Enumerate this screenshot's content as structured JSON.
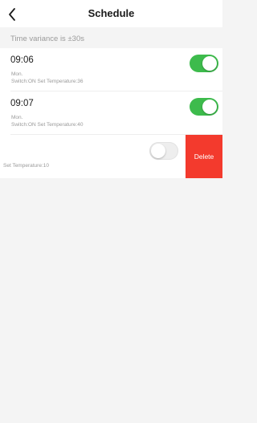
{
  "header": {
    "title": "Schedule",
    "back_icon": "chevron-left-icon"
  },
  "variance": {
    "text": "Time variance is  ±30s"
  },
  "schedules": [
    {
      "time": "09:06",
      "days": "Mon.",
      "detail": "Switch:ON Set Temperature:36",
      "enabled": true
    },
    {
      "time": "09:07",
      "days": "Mon.",
      "detail": "Switch:ON Set Temperature:40",
      "enabled": true
    },
    {
      "detail": "Set Temperature:10",
      "enabled": false,
      "delete_label": "Delete"
    }
  ],
  "colors": {
    "toggle_on": "#3dbb4c",
    "delete": "#f33a2d",
    "background": "#f4f4f4"
  }
}
